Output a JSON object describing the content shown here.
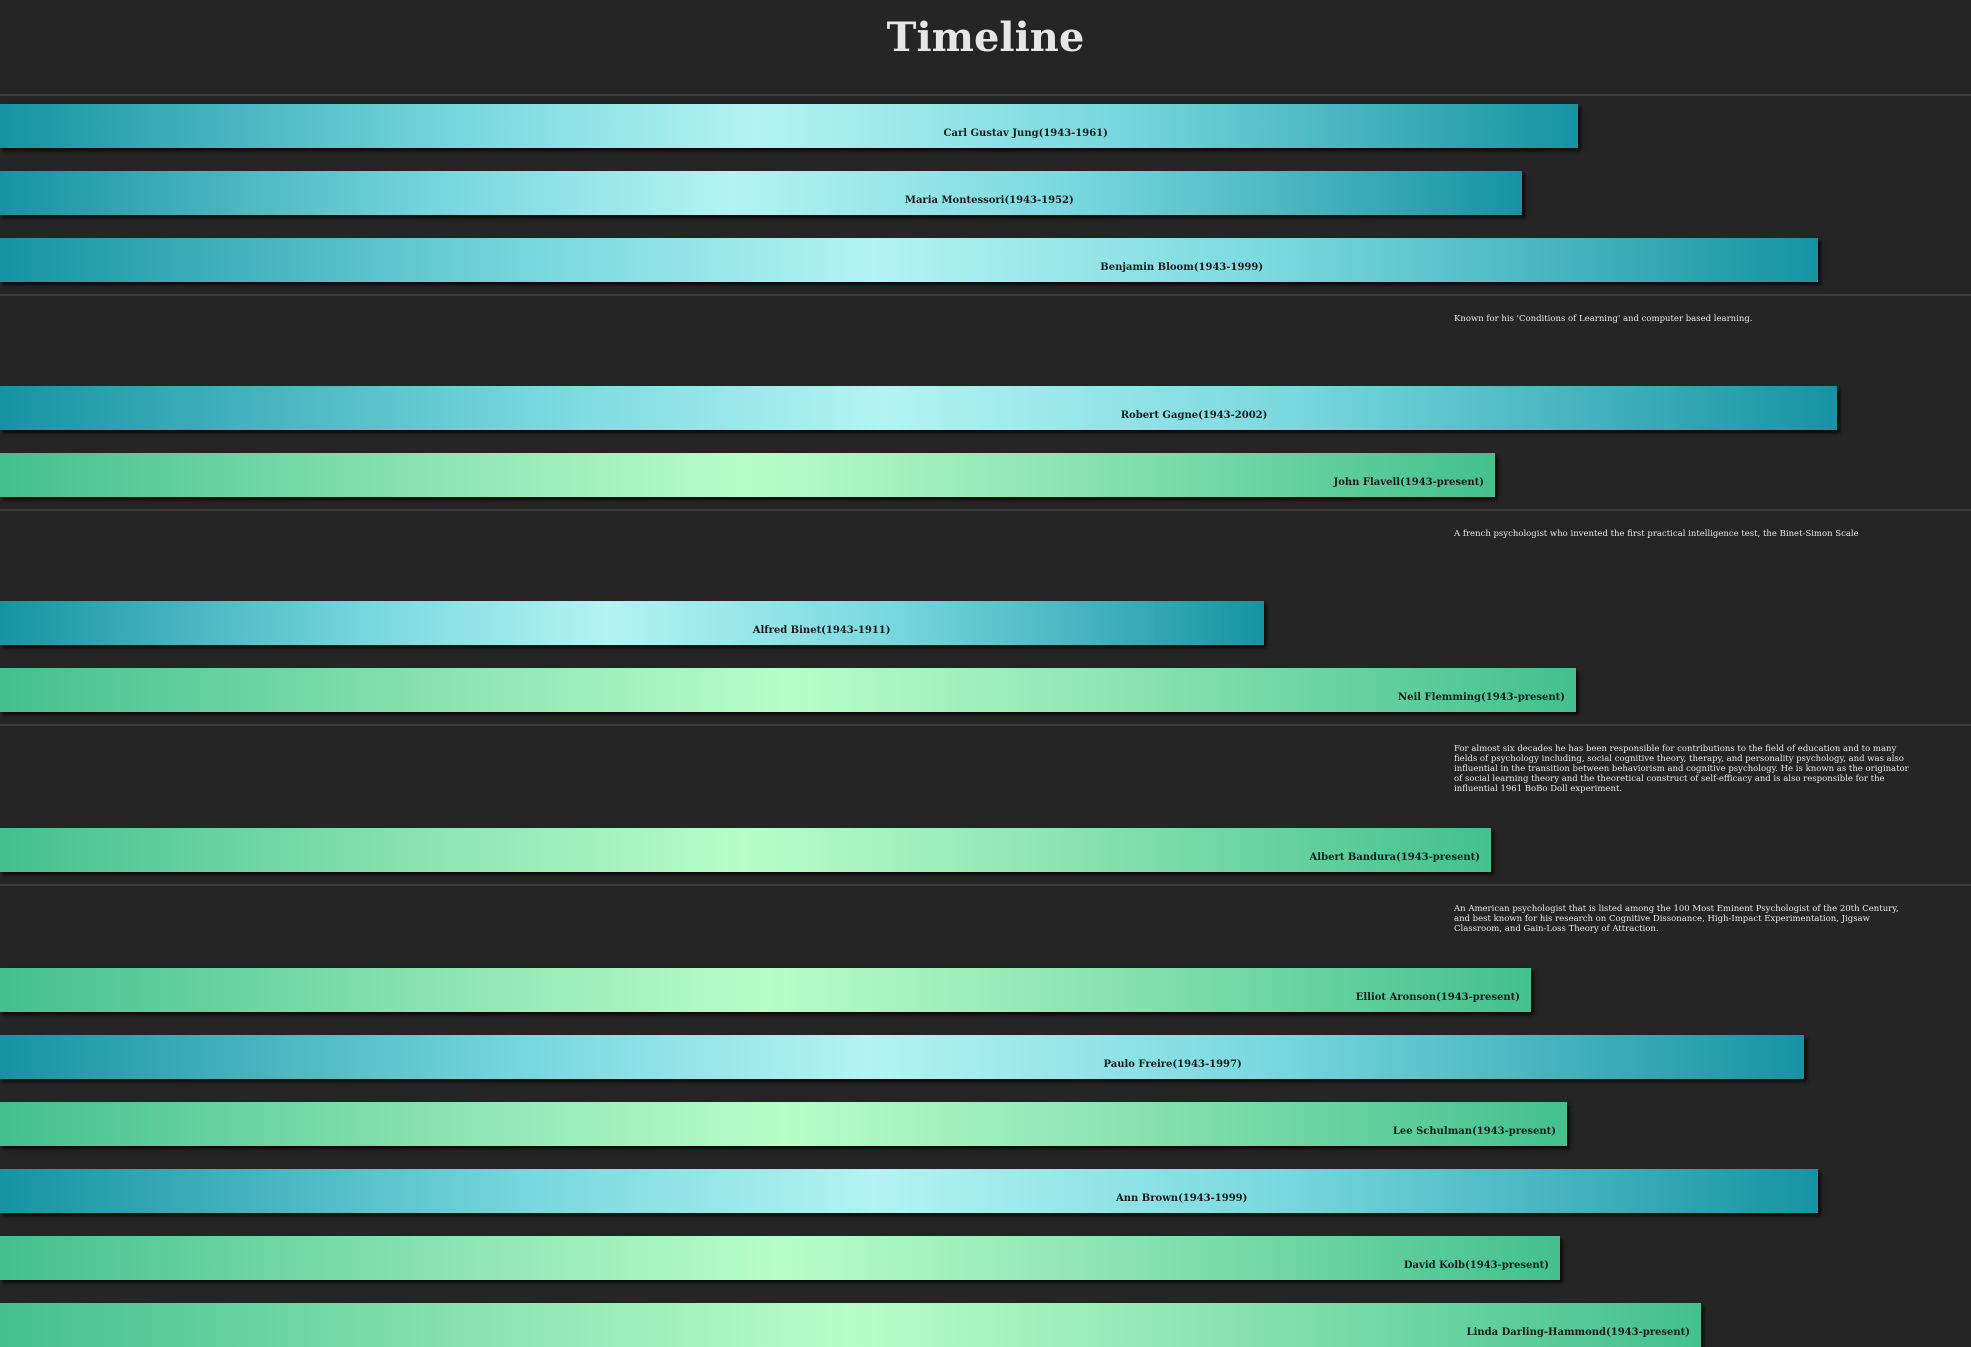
{
  "page": {
    "title": "Timeline"
  },
  "colors": {
    "background": "#252525",
    "teal": "#1693a3",
    "teal_light": "#b3f3f3",
    "green": "#43c08e",
    "green_light": "#b8fdc8"
  },
  "chart_data": {
    "type": "bar",
    "orientation": "horizontal",
    "title": "Timeline",
    "xlabel": "",
    "ylabel": "",
    "grid": false,
    "rows": [
      {
        "label": "Carl Gustav Jung(1943-1961)",
        "start": 1943,
        "end": 1961,
        "status": "deceased",
        "note": ""
      },
      {
        "label": "Maria Montessori(1943-1952)",
        "start": 1943,
        "end": 1952,
        "status": "deceased",
        "note": ""
      },
      {
        "label": "Benjamin Bloom(1943-1999)",
        "start": 1943,
        "end": 1999,
        "status": "deceased",
        "note": ""
      },
      {
        "label": "Robert Gagne(1943-2002)",
        "start": 1943,
        "end": 2002,
        "status": "deceased",
        "note": "Known for his 'Conditions of Learning' and computer based learning."
      },
      {
        "label": "John Flavell(1943-present)",
        "start": 1943,
        "end": "present",
        "status": "living",
        "note": ""
      },
      {
        "label": "Alfred Binet(1943-1911)",
        "start": 1943,
        "end": 1911,
        "status": "deceased",
        "note": "A french psychologist who invented the first practical intelligence test, the Binet-Simon Scale"
      },
      {
        "label": "Neil Flemming(1943-present)",
        "start": 1943,
        "end": "present",
        "status": "living",
        "note": ""
      },
      {
        "label": "Albert Bandura(1943-present)",
        "start": 1943,
        "end": "present",
        "status": "living",
        "note": "For almost six decades he has been responsible for contributions to the field of education and to many fields of psychology including, social cognitive theory, therapy, and personality psychology, and was also influential in the transition between behaviorism and cognitive psychology. He is known as the originator of social learning theory and the theoretical construct of self-efficacy and is also responsible for the influential 1961 BoBo Doll experiment."
      },
      {
        "label": "Elliot Aronson(1943-present)",
        "start": 1943,
        "end": "present",
        "status": "living",
        "note": "An American psychologist that is listed among the 100 Most Eminent Psychologist of the 20th Century, and best known for his research on Cognitive Dissonance, High-Impact Experimentation, Jigsaw Classroom, and Gain-Loss Theory of Attraction."
      },
      {
        "label": "Paulo Freire(1943-1997)",
        "start": 1943,
        "end": 1997,
        "status": "deceased",
        "note": ""
      },
      {
        "label": "Lee Schulman(1943-present)",
        "start": 1943,
        "end": "present",
        "status": "living",
        "note": ""
      },
      {
        "label": "Ann Brown(1943-1999)",
        "start": 1943,
        "end": 1999,
        "status": "deceased",
        "note": ""
      },
      {
        "label": "David Kolb(1943-present)",
        "start": 1943,
        "end": "present",
        "status": "living",
        "note": ""
      },
      {
        "label": "Linda Darling-Hammond(1943-present)",
        "start": 1943,
        "end": "present",
        "status": "living",
        "note": ""
      }
    ]
  }
}
